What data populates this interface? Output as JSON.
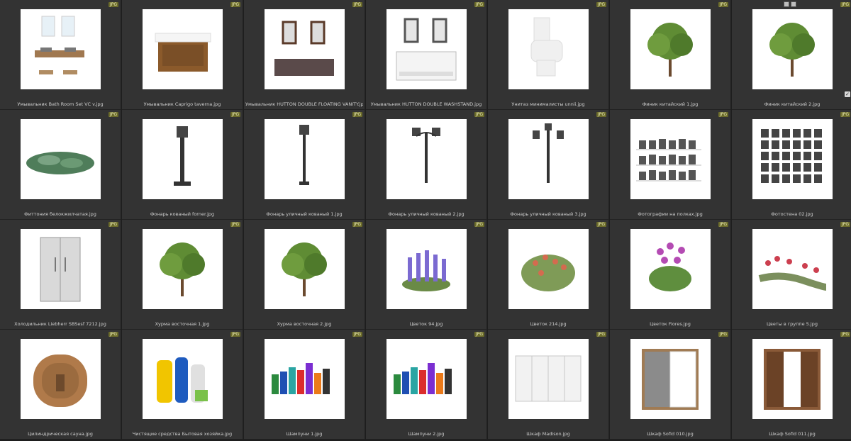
{
  "badge_label": "JPG",
  "items": [
    {
      "caption": "Умывальник Bath Room Set VC v.jpg",
      "icon": "bathroom-sink-set-icon"
    },
    {
      "caption": "Умывальник Caprigo taverna.jpg",
      "icon": "vanity-cabinet-icon"
    },
    {
      "caption": "Умывальник HUTTON DOUBLE FLOATING VANITY.jpg",
      "icon": "double-vanity-icon"
    },
    {
      "caption": "Умывальник HUTTON DOUBLE WASHSTAND.jpg",
      "icon": "washstand-icon"
    },
    {
      "caption": "Унитаз минималисты unnii.jpg",
      "icon": "toilet-icon"
    },
    {
      "caption": "Финик китайский 1.jpg",
      "icon": "tree-icon"
    },
    {
      "caption": "Финик китайский 2.jpg",
      "icon": "tree-icon"
    },
    {
      "caption": "Фиттония белокжилчатая.jpg",
      "icon": "ground-plant-icon"
    },
    {
      "caption": "Фонарь кованый forner.jpg",
      "icon": "ornate-lamp-icon"
    },
    {
      "caption": "Фонарь уличный кованый 1.jpg",
      "icon": "street-lamp-icon"
    },
    {
      "caption": "Фонарь уличный кованый 2.jpg",
      "icon": "double-street-lamp-icon"
    },
    {
      "caption": "Фонарь уличный кованый 3.jpg",
      "icon": "triple-street-lamp-icon"
    },
    {
      "caption": "Фотографии на полках.jpg",
      "icon": "photo-shelves-icon"
    },
    {
      "caption": "Фотостена 02.jpg",
      "icon": "photo-wall-icon"
    },
    {
      "caption": "Холодильник Liebherr SBSesf 7212.jpg",
      "icon": "refrigerator-icon"
    },
    {
      "caption": "Хурма восточная 1.jpg",
      "icon": "tree-icon"
    },
    {
      "caption": "Хурма восточная 2.jpg",
      "icon": "tree-icon"
    },
    {
      "caption": "Цветок 94.jpg",
      "icon": "lavender-icon"
    },
    {
      "caption": "Цветок 214.jpg",
      "icon": "flower-bush-icon"
    },
    {
      "caption": "Цветок Fiores.jpg",
      "icon": "flower-plant-icon"
    },
    {
      "caption": "Цветы в группе 5.jpg",
      "icon": "flower-group-icon"
    },
    {
      "caption": "Цилиндрическая сауна.jpg",
      "icon": "barrel-sauna-icon"
    },
    {
      "caption": "Чистящие средства Бытовая хозяйка.jpg",
      "icon": "cleaning-bottles-icon"
    },
    {
      "caption": "Шампуни 1.jpg",
      "icon": "shampoo-bottles-icon"
    },
    {
      "caption": "Шампуни 2.jpg",
      "icon": "shampoo-bottles-icon"
    },
    {
      "caption": "Шкаф Madison.jpg",
      "icon": "white-wardrobe-icon"
    },
    {
      "caption": "Шкаф Sofid 010.jpg",
      "icon": "wardrobe-gray-icon"
    },
    {
      "caption": "Шкаф Sofid 011.jpg",
      "icon": "wardrobe-wood-icon"
    }
  ],
  "colors": {
    "background": "#1e1e1e",
    "cell": "#333333",
    "caption_text": "#cfcfcf",
    "badge_bg": "#6b6b2a"
  }
}
